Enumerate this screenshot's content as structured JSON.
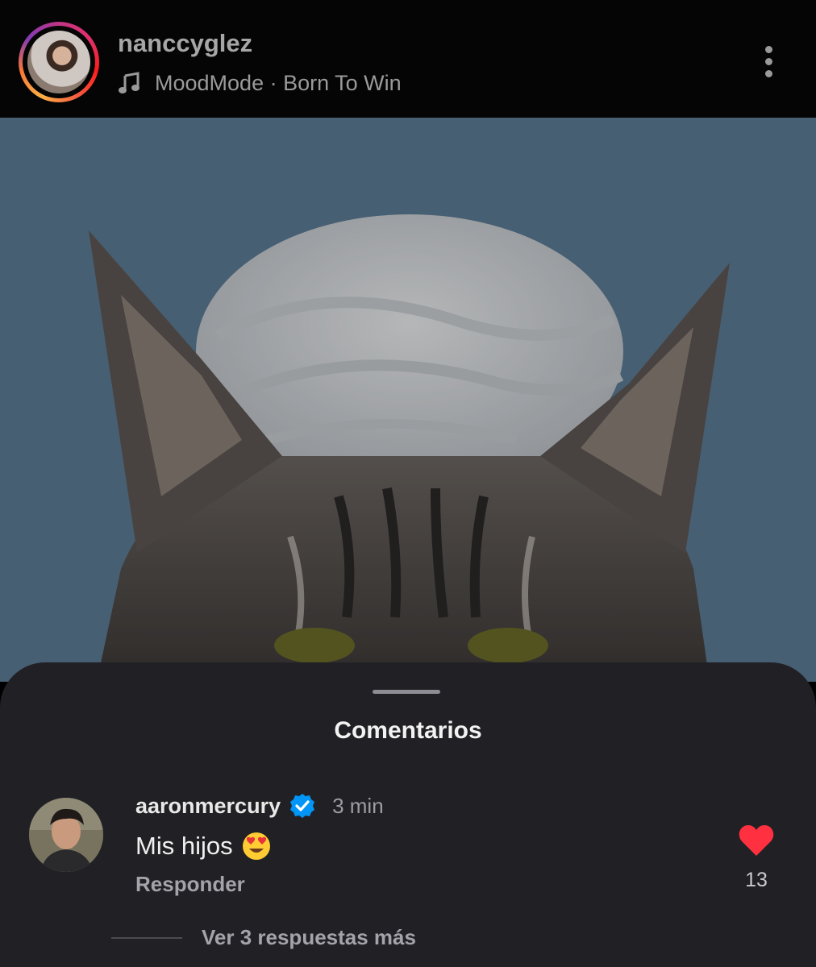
{
  "header": {
    "username": "nanccyglez",
    "music_icon": "music-note-icon",
    "music_text": "MoodMode · Born To Win",
    "more_icon": "more-vertical-icon"
  },
  "photo": {
    "description_icon": "cat-with-towel-photo"
  },
  "comments_sheet": {
    "title": "Comentarios",
    "comments": [
      {
        "username": "aaronmercury",
        "verified": true,
        "time": "3 min",
        "text": "Mis hijos",
        "emoji": "heart-eyes-emoji-icon",
        "reply_label": "Responder",
        "liked": true,
        "like_count": "13",
        "view_replies_label": "Ver 3 respuestas más"
      }
    ]
  },
  "colors": {
    "header_bg": "#050505",
    "sheet_bg": "#212125",
    "like_red": "#ff3040",
    "verified_blue": "#0095f6"
  }
}
